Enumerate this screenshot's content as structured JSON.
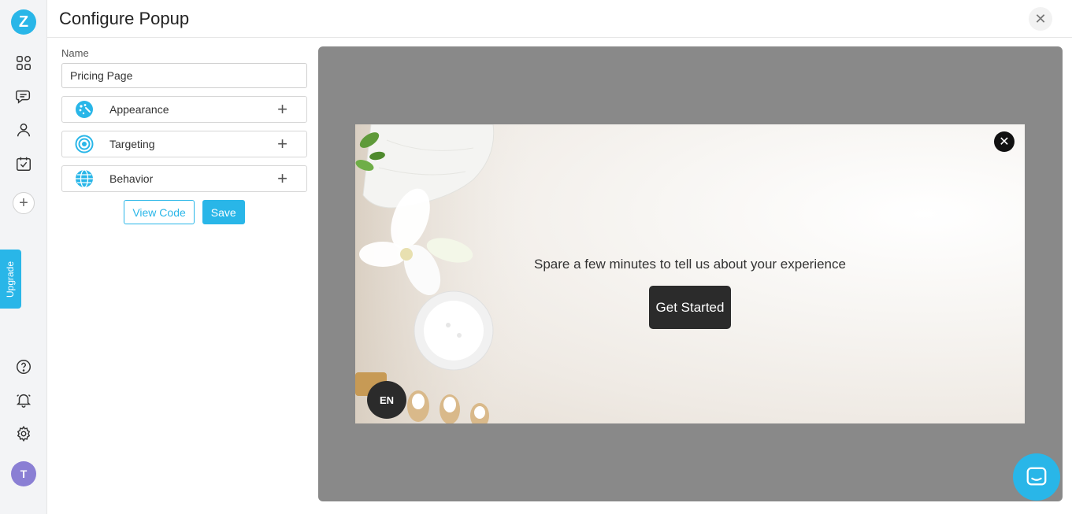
{
  "app": {
    "logo_letter": "Z"
  },
  "header": {
    "title": "Configure Popup",
    "close_glyph": "✕"
  },
  "rail": {
    "add_glyph": "+",
    "upgrade_label": "Upgrade",
    "avatar_initial": "T"
  },
  "panel": {
    "name_label": "Name",
    "name_value": "Pricing Page",
    "sections": [
      {
        "label": "Appearance",
        "icon": "palette-icon"
      },
      {
        "label": "Targeting",
        "icon": "target-icon"
      },
      {
        "label": "Behavior",
        "icon": "globe-icon"
      }
    ],
    "plus_glyph": "+",
    "view_code_label": "View Code",
    "save_label": "Save"
  },
  "preview": {
    "message": "Spare a few minutes to tell us about your experience",
    "cta_label": "Get Started",
    "language": "EN",
    "close_glyph": "✕"
  },
  "colors": {
    "accent": "#29b6e8",
    "preview_bg": "#898989",
    "cta_bg": "#2b2b2b"
  }
}
